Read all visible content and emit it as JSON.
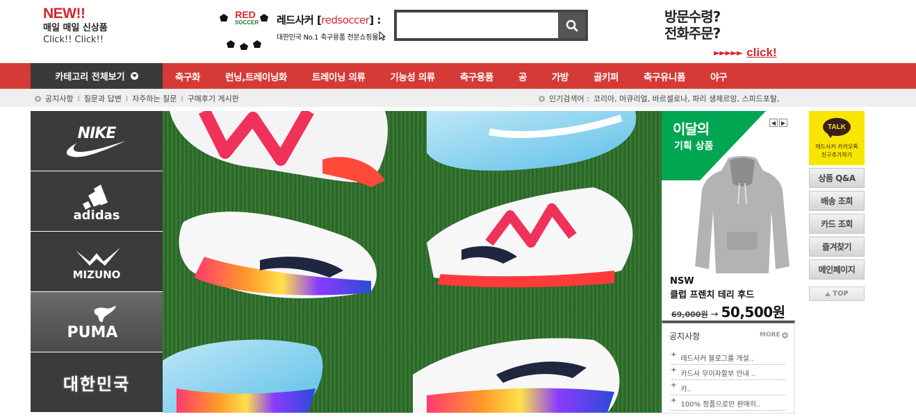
{
  "header": {
    "promo_new": "NEW!!",
    "promo_line2": "매일 매일 신상품",
    "promo_line3": "Click!! Click!!",
    "logo_badge": "RED SOCCER",
    "brand_kr": "레드사커",
    "brand_en": "redsoccer",
    "brand_tagline": "대한민국 No.1 축구용품 전문쇼핑몰",
    "search_placeholder": "",
    "visit_line1": "방문수령?",
    "visit_line2": "전화주문?",
    "click_arrows": "►►►►►",
    "click_label": "click!"
  },
  "nav": {
    "category_all": "카테고리 전체보기",
    "items": [
      "축구화",
      "런닝,트레이닝화",
      "트레이닝 의류",
      "기능성 의류",
      "축구용품",
      "공",
      "가방",
      "골키퍼",
      "축구유니폼",
      "야구"
    ]
  },
  "subbar": {
    "links": [
      "공지사항",
      "질문과 답변",
      "자주하는 질문",
      "구매후기 게시판"
    ],
    "popular_label": "인기검색어 :",
    "popular_terms": "코리아, 머큐리얼, 바르셀로나, 파리 생제르망, 스피드포탈,"
  },
  "brands": [
    "NIKE",
    "adidas",
    "MIZUNO",
    "PUMA",
    "대한민국"
  ],
  "promo": {
    "title1": "이달의",
    "title2": "기획 상품",
    "product_line1": "NSW",
    "product_line2": "클럽 프렌치 테리 후드",
    "old_price": "69,000원",
    "arrow": "→",
    "new_price": "50,500원",
    "accent": "#00a651"
  },
  "notice": {
    "title": "공지사항",
    "more": "MORE",
    "items": [
      "레드사커 블로그를 개설..",
      "카드사 무이자할부 안내 ..",
      "카..",
      "100% 정품으로만 판매히.."
    ]
  },
  "quick": {
    "talk_bubble": "TALK",
    "talk_line1": "레드사커 카카오톡",
    "talk_line2": "친구추가하기",
    "buttons": [
      "상품 Q&A",
      "배송 조회",
      "카드 조회",
      "즐겨찾기",
      "메인페이지"
    ],
    "top": "TOP"
  },
  "colors": {
    "brand_red": "#d63a36",
    "dark_tile": "#3b3b3b",
    "kakao_yellow": "#f7e600"
  }
}
